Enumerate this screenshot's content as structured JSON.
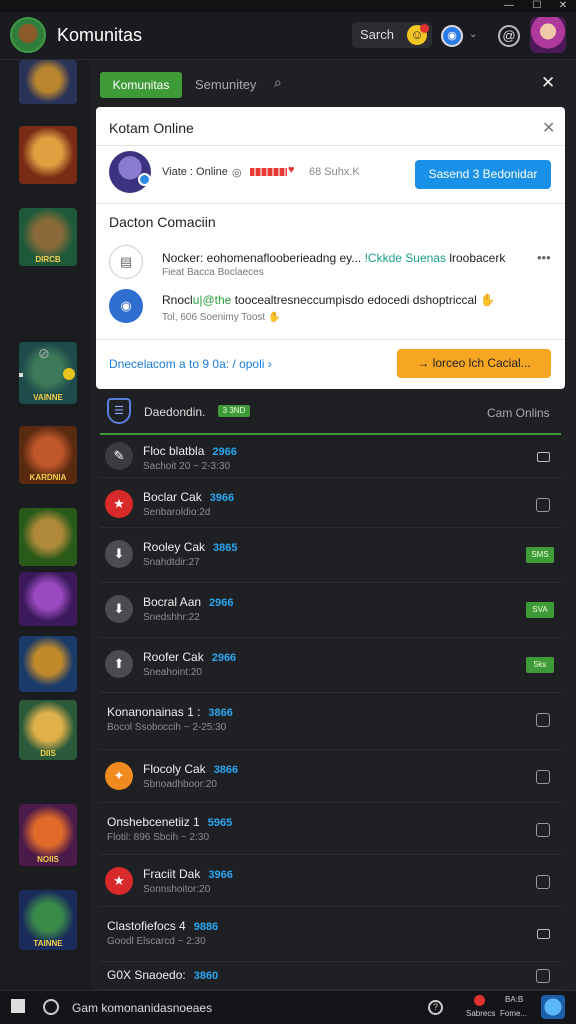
{
  "window": {
    "minimize": "—",
    "maximize": "☐",
    "close": "✕"
  },
  "header": {
    "title": "Komunitas",
    "search_label": "Sarch",
    "emoji": "☺",
    "chevron": "⌄",
    "at": "@"
  },
  "sidebar": {
    "tiles": [
      {
        "label": "",
        "colors": [
          "#2a3358",
          "#b8862f"
        ]
      },
      {
        "label": "",
        "colors": [
          "#7a2b16",
          "#e0a042"
        ]
      },
      {
        "label": "DIRCB",
        "colors": [
          "#1e5a3a",
          "#8a6a3a"
        ]
      },
      {
        "label": "VAINNE",
        "colors": [
          "#1e4a4a",
          "#3d7a5a"
        ]
      },
      {
        "label": "KARDNIA",
        "colors": [
          "#5a2a10",
          "#c0582a"
        ]
      },
      {
        "label": "",
        "colors": [
          "#2a5a1a",
          "#b08a3a"
        ]
      },
      {
        "label": "",
        "colors": [
          "#3a1a5a",
          "#9a4ac0"
        ]
      },
      {
        "label": "",
        "colors": [
          "#1a3a6a",
          "#c08a2a"
        ]
      },
      {
        "label": "DIIS",
        "colors": [
          "#2a5a3a",
          "#e0b04a"
        ]
      },
      {
        "label": "NOIIS",
        "colors": [
          "#4a1a4a",
          "#e06a2a"
        ]
      },
      {
        "label": "TAINNE",
        "colors": [
          "#1a2a5a",
          "#3a8a4a"
        ]
      }
    ]
  },
  "tabs": {
    "active": "Komunitas",
    "second": "Semunitey",
    "close": "✕"
  },
  "panel": {
    "title": "Kotam Online",
    "close": "✕",
    "user_name": "Viate : Online",
    "user_status": "◎",
    "heart": "♥",
    "user_extra": "68 Suhx.K",
    "primary_button": "Sasend  3  Bedonidar",
    "section_title": "Dacton Comaciin",
    "items": [
      {
        "icon": "▤",
        "text_a": "Nocker: eohomenaflooberieadng ey...",
        "text_hl": "!Ckkde Suenas",
        "text_b": "lroobacerk",
        "sub": "Fieat Bacca Boclaeces"
      },
      {
        "icon": "◉",
        "text_a": "Rnocl",
        "text_hl": "u|@the",
        "text_b": "toocealtresneccumpisdo edocedi dshoptriccal ✋",
        "sub": "Tol, 606 Soenimy Toost ✋"
      }
    ],
    "more": "•••",
    "link": "Dnecelacom a to 9 0a: / opoli ›",
    "cta_button": "→  lorceo lch Cacial..."
  },
  "group": {
    "title": "Daedondin.",
    "pill": "3 3ND",
    "right": "Cam Onlins",
    "shield": "☰"
  },
  "rows": [
    {
      "avatar": "✎",
      "avatar_bg": "#3a3c42",
      "name": "Floc blatbla",
      "num": "2966",
      "sub": "Sachoit 20 ~ 2-3:30",
      "right": "msg"
    },
    {
      "avatar": "★",
      "avatar_bg": "#d82a2a",
      "name": "Boclar Cak",
      "num": "3966",
      "sub": "Senbaroldio:2d",
      "right": "check"
    },
    {
      "avatar": "⬇",
      "avatar_bg": "#4a4c52",
      "name": "Rooley Cak",
      "num": "3865",
      "sub": "Snahdtdir:27",
      "right": "green",
      "pill": "SMS"
    },
    {
      "avatar": "⬇",
      "avatar_bg": "#4a4c52",
      "name": "Bocral Aan",
      "num": "2966",
      "sub": "Snedshhr:22",
      "right": "green",
      "pill": "SVA"
    },
    {
      "avatar": "⬆",
      "avatar_bg": "#4a4c52",
      "name": "Roofer Cak",
      "num": "2966",
      "sub": "Sneahoint:20",
      "right": "green",
      "pill": "5ks"
    },
    {
      "avatar": "",
      "avatar_bg": "",
      "name": "Konanonainas  1 :",
      "num": "3866",
      "sub": "Bocol Ssoboccih ~ 2-25:30",
      "right": "check",
      "plain": true
    },
    {
      "avatar": "✦",
      "avatar_bg": "#f08a1e",
      "name": "Flocoly Cak",
      "num": "3866",
      "sub": "Sbnoadhboor:20",
      "right": "check"
    },
    {
      "avatar": "",
      "avatar_bg": "",
      "name": "Onshebcenetiiz  1",
      "num": "5965",
      "sub": "Flotil: 896 Sbcih ~ 2:30",
      "right": "check",
      "plain": true
    },
    {
      "avatar": "★",
      "avatar_bg": "#d82a2a",
      "name": "Fraciit Dak",
      "num": "3966",
      "sub": "Sonnshoitor:20",
      "right": "check"
    },
    {
      "avatar": "",
      "avatar_bg": "",
      "name": "Clastofiefocs  4",
      "num": "9886",
      "sub": "Goodl Elscarcd ~ 2:30",
      "right": "msg",
      "plain": true
    },
    {
      "avatar": "",
      "avatar_bg": "",
      "name": "G0X    Snaoedo:",
      "num": "3860",
      "sub": "",
      "right": "check",
      "plain": true
    }
  ],
  "bottombar": {
    "text": "Gam komonanidasnoeaes",
    "help": "?",
    "mini1": "BA:B",
    "mini2": "Sabrecs",
    "mini3": "Fome..."
  }
}
